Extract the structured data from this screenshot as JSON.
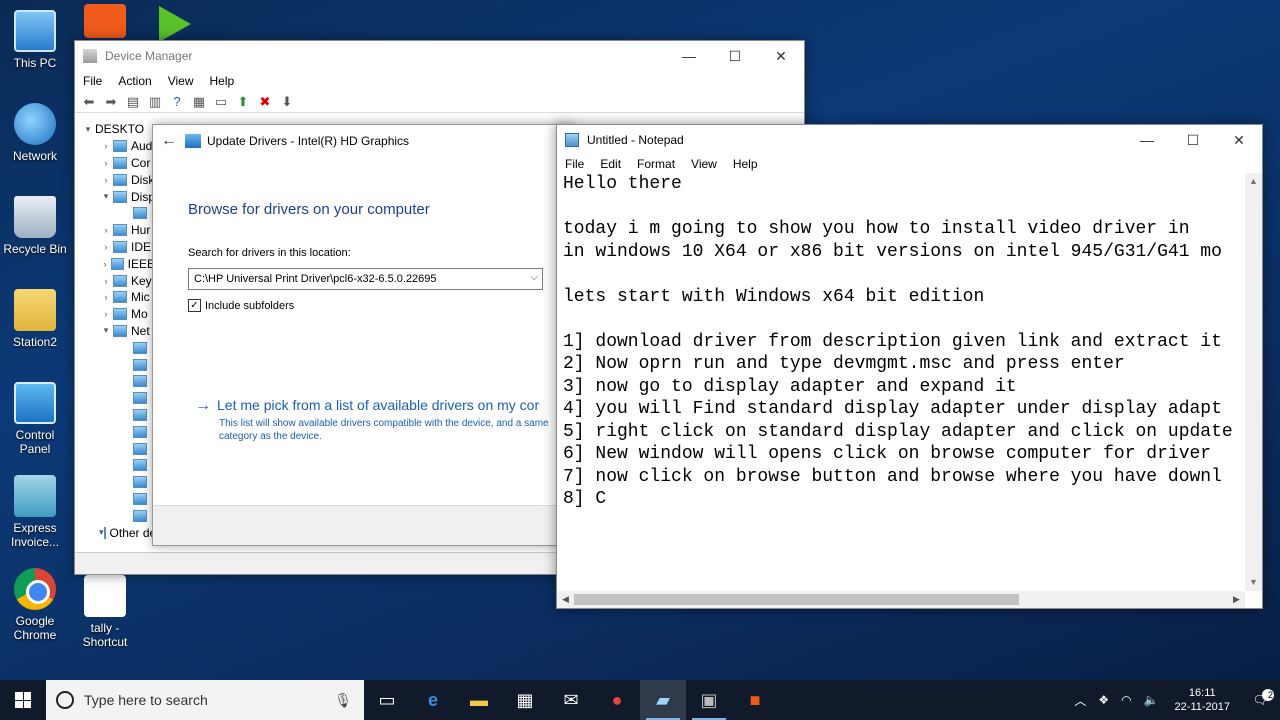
{
  "desktop": {
    "icons": [
      {
        "label": "This PC",
        "icon": "computer-icon"
      },
      {
        "label": "Network",
        "icon": "network-icon"
      },
      {
        "label": "Recycle Bin",
        "icon": "recycle-bin-icon"
      },
      {
        "label": "Station2",
        "icon": "user-folder-icon"
      },
      {
        "label": "Control Panel",
        "icon": "control-panel-icon"
      },
      {
        "label": "Express Invoice...",
        "icon": "express-invoice-icon"
      },
      {
        "label": "Google Chrome",
        "icon": "chrome-icon"
      },
      {
        "label": "tally - Shortcut",
        "icon": "tally-icon"
      }
    ]
  },
  "device_manager": {
    "title": "Device Manager",
    "menu": [
      "File",
      "Action",
      "View",
      "Help"
    ],
    "tree": [
      {
        "arrow": "▾",
        "label": "DESKTO"
      },
      {
        "arrow": "›",
        "label": "Aud"
      },
      {
        "arrow": "›",
        "label": "Cor"
      },
      {
        "arrow": "›",
        "label": "Disk"
      },
      {
        "arrow": "▾",
        "label": "Disp"
      },
      {
        "arrow": "",
        "label": ""
      },
      {
        "arrow": "›",
        "label": "Hur"
      },
      {
        "arrow": "›",
        "label": "IDE"
      },
      {
        "arrow": "›",
        "label": "IEEE"
      },
      {
        "arrow": "›",
        "label": "Key"
      },
      {
        "arrow": "›",
        "label": "Mic"
      },
      {
        "arrow": "›",
        "label": "Mo"
      },
      {
        "arrow": "▾",
        "label": "Net"
      },
      {
        "arrow": "",
        "label": ""
      },
      {
        "arrow": "",
        "label": ""
      },
      {
        "arrow": "",
        "label": ""
      },
      {
        "arrow": "",
        "label": ""
      },
      {
        "arrow": "",
        "label": ""
      },
      {
        "arrow": "",
        "label": ""
      },
      {
        "arrow": "",
        "label": ""
      },
      {
        "arrow": "",
        "label": ""
      },
      {
        "arrow": "",
        "label": ""
      },
      {
        "arrow": "",
        "label": ""
      },
      {
        "arrow": "",
        "label": ""
      },
      {
        "arrow": "▾",
        "label": "Other devices"
      }
    ]
  },
  "update_drivers": {
    "header": "Update Drivers - Intel(R) HD Graphics",
    "heading": "Browse for drivers on your computer",
    "search_label": "Search for drivers in this location:",
    "path_value": "C:\\HP Universal Print Driver\\pcl6-x32-6.5.0.22695",
    "include_subfolders": "Include subfolders",
    "pick_link": "Let me pick from a list of available drivers on my cor",
    "pick_desc": "This list will show available drivers compatible with the device, and a same category as the device."
  },
  "notepad": {
    "title": "Untitled - Notepad",
    "menu": [
      "File",
      "Edit",
      "Format",
      "View",
      "Help"
    ],
    "lines": [
      "Hello there",
      "",
      "today i m going to show you how to install video driver in",
      "in windows 10 X64 or x86 bit versions on intel 945/G31/G41 mo",
      "",
      "lets start with Windows x64 bit edition",
      "",
      "1] download driver from description given link and extract it",
      "2] Now oprn run and type devmgmt.msc and press enter",
      "3] now go to display adapter and expand it",
      "4] you will Find standard display adapter under display adapt",
      "5] right click on standard display adapter and click on update",
      "6] New window will opens click on browse computer for driver",
      "7] now click on browse button and browse where you have downl",
      "8] C"
    ]
  },
  "taskbar": {
    "search_placeholder": "Type here to search",
    "time": "16:11",
    "date": "22-11-2017",
    "notification_count": "2"
  }
}
